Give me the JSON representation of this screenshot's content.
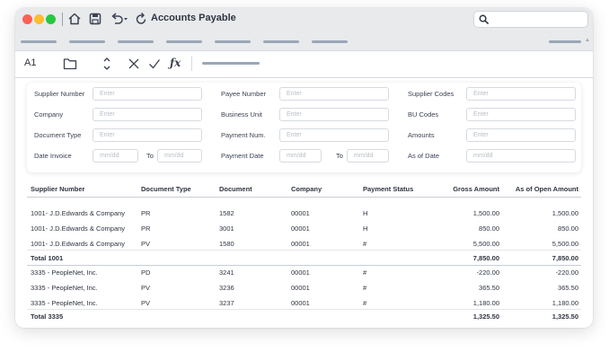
{
  "window": {
    "title": "Accounts Payable",
    "search_placeholder": ""
  },
  "formula_bar": {
    "cell_ref": "A1",
    "fx_label": "ƒx"
  },
  "filters": {
    "col1": [
      {
        "label": "Supplier Number",
        "placeholder": "Enter"
      },
      {
        "label": "Company",
        "placeholder": "Enter"
      },
      {
        "label": "Document Type",
        "placeholder": "Enter"
      }
    ],
    "col2": [
      {
        "label": "Payee Number",
        "placeholder": "Enter"
      },
      {
        "label": "Business Unit",
        "placeholder": "Enter"
      },
      {
        "label": "Payment Num.",
        "placeholder": "Enter"
      }
    ],
    "col3": [
      {
        "label": "Supplier Codes",
        "placeholder": "Enter"
      },
      {
        "label": "BU Codes",
        "placeholder": "Enter"
      },
      {
        "label": "Amounts",
        "placeholder": "Enter"
      }
    ],
    "date_invoice": {
      "label": "Date Invoice",
      "from": "mm/dd",
      "to_label": "To",
      "to": "mm/dd"
    },
    "payment_date": {
      "label": "Payment Date",
      "from": "mm/dd",
      "to_label": "To",
      "to": "mm/dd"
    },
    "as_of_date": {
      "label": "As of Date",
      "placeholder": "mm/dd"
    }
  },
  "table": {
    "headers": [
      "Supplier Number",
      "Document Type",
      "Document",
      "Company",
      "Payment Status",
      "Gross Amount",
      "As of Open Amount"
    ],
    "rows": [
      [
        "1001- J.D.Edwards & Company",
        "PR",
        "1582",
        "00001",
        "H",
        "1,500.00",
        "1,500.00"
      ],
      [
        "1001- J.D.Edwards & Company",
        "PR",
        "3001",
        "00001",
        "H",
        "850.00",
        "850.00"
      ],
      [
        "1001- J.D.Edwards & Company",
        "PV",
        "1580",
        "00001",
        "#",
        "5,500.00",
        "5,500.00"
      ],
      [
        "Total 1001",
        "",
        "",
        "",
        "",
        "7,850.00",
        "7,850.00"
      ],
      [
        "3335 - PeopleNet, Inc.",
        "PD",
        "3241",
        "00001",
        "#",
        "-220.00",
        "-220.00"
      ],
      [
        "3335 - PeopleNet, Inc.",
        "PV",
        "3236",
        "00001",
        "#",
        "365.50",
        "365.50"
      ],
      [
        "3335 - PeopleNet, Inc.",
        "PV",
        "3237",
        "00001",
        "#",
        "1,180.00",
        "1,180.00"
      ],
      [
        "Total 3335",
        "",
        "",
        "",
        "",
        "1,325.50",
        "1,325.50"
      ]
    ]
  }
}
